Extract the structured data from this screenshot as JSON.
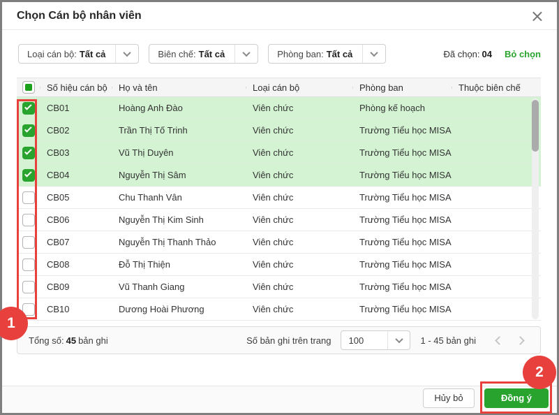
{
  "dialog": {
    "title": "Chọn Cán bộ nhân viên"
  },
  "icons": {
    "close": "×",
    "chevron_down": "chevron-down",
    "check": "checkmark",
    "prev": "chevron-left",
    "next": "chevron-right"
  },
  "filters": [
    {
      "label": "Loại cán bộ:",
      "value": "Tất cả"
    },
    {
      "label": "Biên chế:",
      "value": "Tất cả"
    },
    {
      "label": "Phòng ban:",
      "value": "Tất cả"
    }
  ],
  "selection": {
    "label": "Đã chọn:",
    "count": "04",
    "clear_label": "Bỏ chọn"
  },
  "table": {
    "columns": [
      "Số hiệu cán bộ",
      "Họ và tên",
      "Loại cán bộ",
      "Phòng ban",
      "Thuộc biên chế"
    ],
    "rows": [
      {
        "code": "CB01",
        "name": "Hoàng Anh Đào",
        "type": "Viên chức",
        "department": "Phòng kế hoạch",
        "tenure": "",
        "checked": true
      },
      {
        "code": "CB02",
        "name": "Trần Thị Tố Trinh",
        "type": "Viên chức",
        "department": "Trường Tiểu học MISA",
        "tenure": "",
        "checked": true
      },
      {
        "code": "CB03",
        "name": "Vũ Thị Duyên",
        "type": "Viên chức",
        "department": "Trường Tiểu học MISA",
        "tenure": "",
        "checked": true
      },
      {
        "code": "CB04",
        "name": "Nguyễn Thị Sâm",
        "type": "Viên chức",
        "department": "Trường Tiểu học MISA",
        "tenure": "",
        "checked": true
      },
      {
        "code": "CB05",
        "name": "Chu Thanh Vân",
        "type": "Viên chức",
        "department": "Trường Tiểu học MISA",
        "tenure": "",
        "checked": false
      },
      {
        "code": "CB06",
        "name": "Nguyễn Thị Kim Sinh",
        "type": "Viên chức",
        "department": "Trường Tiểu học MISA",
        "tenure": "",
        "checked": false
      },
      {
        "code": "CB07",
        "name": "Nguyễn Thị Thanh Thảo",
        "type": "Viên chức",
        "department": "Trường Tiểu học MISA",
        "tenure": "",
        "checked": false
      },
      {
        "code": "CB08",
        "name": "Đỗ Thị Thiện",
        "type": "Viên chức",
        "department": "Trường Tiểu học MISA",
        "tenure": "",
        "checked": false
      },
      {
        "code": "CB09",
        "name": "Vũ Thanh Giang",
        "type": "Viên chức",
        "department": "Trường Tiểu học MISA",
        "tenure": "",
        "checked": false
      },
      {
        "code": "CB10",
        "name": "Dương Hoài Phương",
        "type": "Viên chức",
        "department": "Trường Tiểu học MISA",
        "tenure": "",
        "checked": false
      }
    ]
  },
  "pagination": {
    "total_label": "Tổng số:",
    "total_value": "45",
    "total_suffix": "bản ghi",
    "per_page_label": "Số bản ghi trên trang",
    "per_page_value": "100",
    "range_label": "1 - 45 bản ghi"
  },
  "actions": {
    "cancel_label": "Hủy bỏ",
    "confirm_label": "Đồng ý"
  },
  "annotations": {
    "step1": "1",
    "step2": "2"
  },
  "colors": {
    "accent_green": "#28a42e",
    "selected_row_bg": "#d3f3d3",
    "annotation_red": "#e8413d"
  }
}
